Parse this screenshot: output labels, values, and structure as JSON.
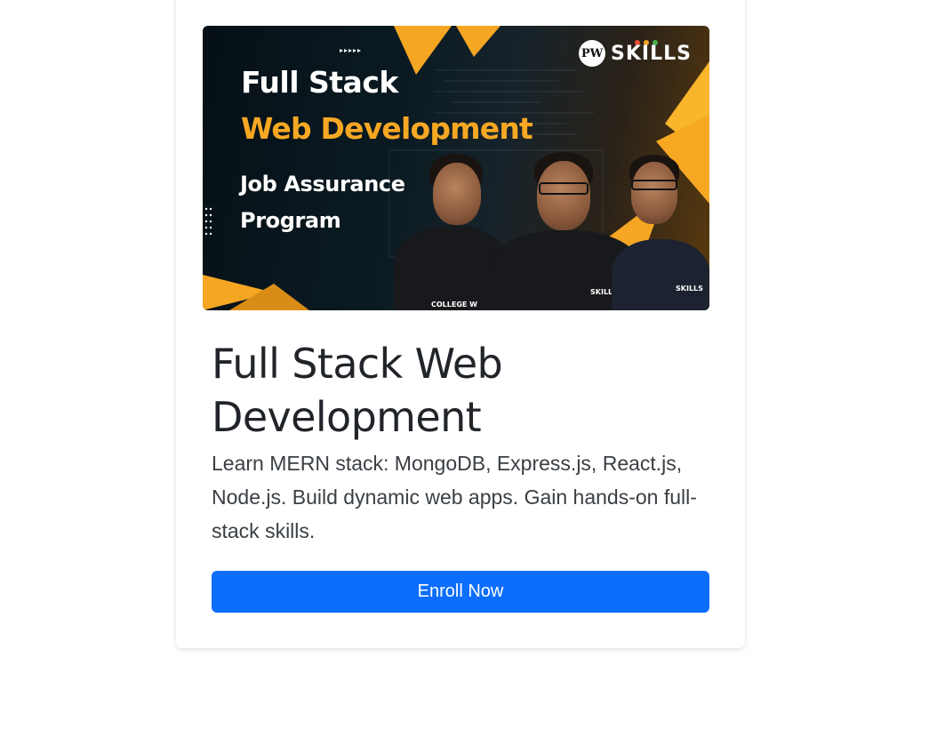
{
  "course": {
    "banner": {
      "line1": "Full Stack",
      "line2": "Web Development",
      "line3": "Job Assurance",
      "line4": "Program",
      "logo_text": "SKILLS",
      "logo_mark": "PW",
      "shirt_label_left": "COLLEGE W",
      "shirt_label_mid": "SKILLS",
      "shirt_label_right": "SKILLS",
      "accent_color": "#f7a823"
    },
    "title": "Full Stack Web Development",
    "description": "Learn MERN stack: MongoDB, Express.js, React.js, Node.js. Build dynamic web apps. Gain hands-on full-stack skills.",
    "button_label": "Enroll Now",
    "button_color": "#0d6efd"
  }
}
